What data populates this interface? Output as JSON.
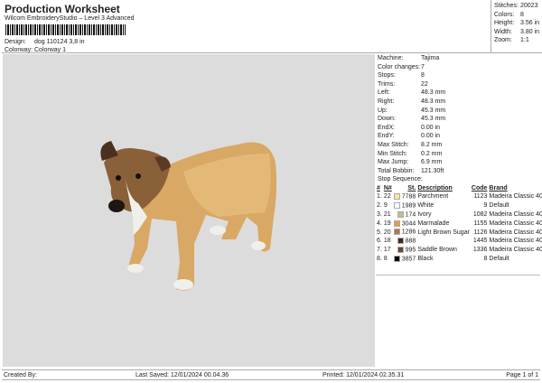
{
  "header": {
    "title": "Production Worksheet",
    "subtitle": "Wilcom EmbroideryStudio – Level 3 Advanced",
    "design_label": "Design:",
    "design_value": "dog 110124 3,8 in",
    "colorway_label": "Colorway:",
    "colorway_value": "Colorway 1"
  },
  "stats": [
    {
      "label": "Stitches:",
      "value": "20023"
    },
    {
      "label": "Colors:",
      "value": "8"
    },
    {
      "label": "Height:",
      "value": "3.56 in"
    },
    {
      "label": "Width:",
      "value": "3.80 in"
    },
    {
      "label": "Zoom:",
      "value": "1:1"
    }
  ],
  "machine": [
    {
      "label": "Machine:",
      "value": "Tajima"
    },
    {
      "label": "Color changes:",
      "value": "7"
    },
    {
      "label": "Stops:",
      "value": "8"
    },
    {
      "label": "Trims:",
      "value": "22"
    },
    {
      "label": "Left:",
      "value": "48.3 mm"
    },
    {
      "label": "Right:",
      "value": "48.3 mm"
    },
    {
      "label": "Up:",
      "value": "45.3 mm"
    },
    {
      "label": "Down:",
      "value": "45.3 mm"
    },
    {
      "label": "EndX:",
      "value": "0.00 in"
    },
    {
      "label": "EndY:",
      "value": "0.00 in"
    },
    {
      "label": "Max Stitch:",
      "value": "8.2 mm"
    },
    {
      "label": "Min Stitch:",
      "value": "0.2 mm"
    },
    {
      "label": "Max Jump:",
      "value": "6.9 mm"
    },
    {
      "label": "Total Bobbin:",
      "value": "121.30ft"
    }
  ],
  "stop_sequence": {
    "title": "Stop Sequence:",
    "headers": [
      "#",
      "N#",
      "St.",
      "Description",
      "Code",
      "Brand"
    ],
    "rows": [
      {
        "idx": "1.",
        "n": "22",
        "color": "#f3e6a6",
        "st": "7788",
        "desc": "Parchment",
        "code": "1123",
        "brand": "Madeira Classic 40"
      },
      {
        "idx": "2.",
        "n": "9",
        "color": "#ffffff",
        "st": "1989",
        "desc": "White",
        "code": "9",
        "brand": "Default"
      },
      {
        "idx": "3.",
        "n": "21",
        "color": "#c9b898",
        "st": "174",
        "desc": "Ivory",
        "code": "1082",
        "brand": "Madeira Classic 40"
      },
      {
        "idx": "4.",
        "n": "19",
        "color": "#ec9a48",
        "st": "3044",
        "desc": "Marmalade",
        "code": "1155",
        "brand": "Madeira Classic 40"
      },
      {
        "idx": "5.",
        "n": "20",
        "color": "#b07848",
        "st": "1286",
        "desc": "Light Brown Sugar",
        "code": "1126",
        "brand": "Madeira Classic 40"
      },
      {
        "idx": "6.",
        "n": "18",
        "color": "#3e2c24",
        "st": "888",
        "desc": "",
        "code": "1445",
        "brand": "Madeira Classic 40"
      },
      {
        "idx": "7.",
        "n": "17",
        "color": "#6a4a30",
        "st": "995",
        "desc": "Saddle Brown",
        "code": "1336",
        "brand": "Madeira Classic 40"
      },
      {
        "idx": "8.",
        "n": "8",
        "color": "#000000",
        "st": "3857",
        "desc": "Black",
        "code": "8",
        "brand": "Default"
      }
    ]
  },
  "footer": {
    "created": "Created By:",
    "saved": "Last Saved: 12/01/2024 00.04.36",
    "printed": "Printed: 12/01/2024 02.35.31",
    "page": "Page 1 of 1"
  }
}
